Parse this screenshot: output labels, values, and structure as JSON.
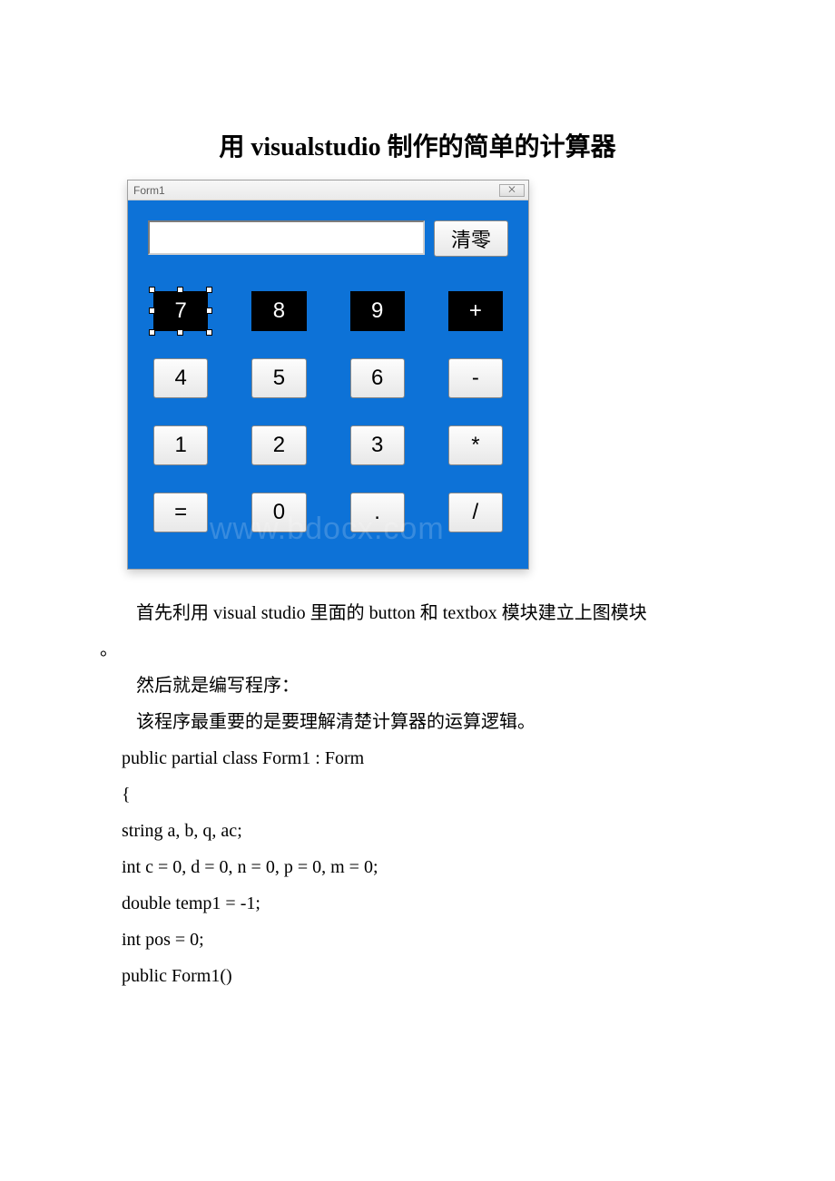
{
  "title": "用 visualstudio 制作的简单的计算器",
  "form": {
    "windowTitle": "Form1",
    "closeGlyph": "⨉",
    "clearLabel": "清零",
    "keys": [
      {
        "label": "7",
        "style": "dark",
        "selected": true
      },
      {
        "label": "8",
        "style": "dark",
        "selected": false
      },
      {
        "label": "9",
        "style": "dark",
        "selected": false
      },
      {
        "label": "+",
        "style": "dark",
        "selected": false
      },
      {
        "label": "4",
        "style": "light",
        "selected": false
      },
      {
        "label": "5",
        "style": "light",
        "selected": false
      },
      {
        "label": "6",
        "style": "light",
        "selected": false
      },
      {
        "label": "-",
        "style": "light",
        "selected": false
      },
      {
        "label": "1",
        "style": "light",
        "selected": false
      },
      {
        "label": "2",
        "style": "light",
        "selected": false
      },
      {
        "label": "3",
        "style": "light",
        "selected": false
      },
      {
        "label": "*",
        "style": "light",
        "selected": false
      },
      {
        "label": "=",
        "style": "light",
        "selected": false
      },
      {
        "label": "0",
        "style": "light",
        "selected": false
      },
      {
        "label": ".",
        "style": "light",
        "selected": false
      },
      {
        "label": "/",
        "style": "light",
        "selected": false
      }
    ]
  },
  "watermark": "www.bdocx.com",
  "paragraphs": {
    "p1a": "首先利用 visual studio 里面的 button 和 textbox 模块建立上图模块",
    "p1b": "。",
    "p2": "然后就是编写程序：",
    "p3": "该程序最重要的是要理解清楚计算器的运算逻辑。",
    "c1": "public partial class Form1 : Form",
    "c2": " {",
    "c3": " string a, b, q, ac;",
    "c4": " int c = 0, d = 0, n = 0, p = 0, m = 0;",
    "c5": " double temp1 = -1;",
    "c6": " int pos = 0;",
    "c7": " public Form1()"
  }
}
